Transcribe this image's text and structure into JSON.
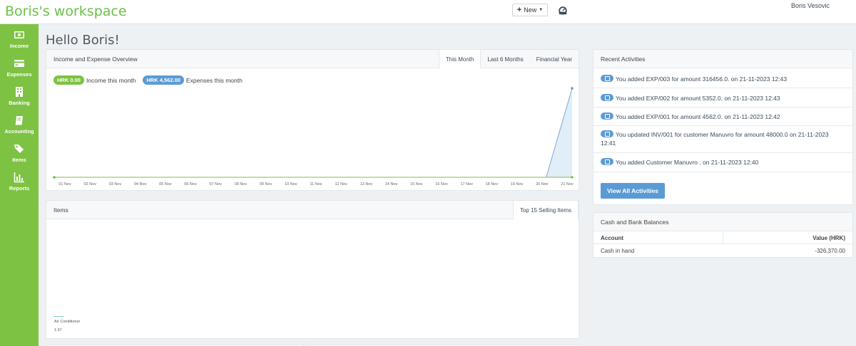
{
  "header": {
    "brand": "Boris's workspace",
    "new_button": "New",
    "user_name": "Boris Vesovic"
  },
  "sidebar": {
    "items": [
      {
        "label": "Income",
        "icon": "money-icon"
      },
      {
        "label": "Expenses",
        "icon": "credit-card-icon"
      },
      {
        "label": "Banking",
        "icon": "building-icon"
      },
      {
        "label": "Accounting",
        "icon": "book-icon"
      },
      {
        "label": "Items",
        "icon": "tags-icon"
      },
      {
        "label": "Reports",
        "icon": "bar-chart-icon"
      }
    ]
  },
  "main": {
    "greeting": "Hello Boris!"
  },
  "overview": {
    "title": "Income and Expense Overview",
    "tabs": [
      "This Month",
      "Last 6 Months",
      "Financial Year"
    ],
    "active_tab": "This Month",
    "income_badge": "HRK 0.00",
    "income_label": "Income this month",
    "expense_badge": "HRK 4,562.00",
    "expense_label": "Expenses this month"
  },
  "chart_data": {
    "type": "area",
    "categories": [
      "01 Nov",
      "02 Nov",
      "03 Nov",
      "04 Nov",
      "05 Nov",
      "06 Nov",
      "07 Nov",
      "08 Nov",
      "09 Nov",
      "10 Nov",
      "11 Nov",
      "12 Nov",
      "13 Nov",
      "14 Nov",
      "15 Nov",
      "16 Nov",
      "17 Nov",
      "18 Nov",
      "19 Nov",
      "20 Nov",
      "21 Nov"
    ],
    "series": [
      {
        "name": "Income this month",
        "color": "#7dc242",
        "values": [
          0,
          0,
          0,
          0,
          0,
          0,
          0,
          0,
          0,
          0,
          0,
          0,
          0,
          0,
          0,
          0,
          0,
          0,
          0,
          0,
          0
        ]
      },
      {
        "name": "Expenses this month",
        "color": "#5b9bd5",
        "values": [
          0,
          0,
          0,
          0,
          0,
          0,
          0,
          0,
          0,
          0,
          0,
          0,
          0,
          0,
          0,
          0,
          0,
          0,
          0,
          0,
          4562
        ]
      }
    ],
    "ylim": [
      0,
      4562
    ]
  },
  "items_panel": {
    "title": "Items",
    "tab": "Top 15 Selling Items",
    "item_label": "Air Conditioner",
    "item_value": "1.57"
  },
  "activities": {
    "title": "Recent Activities",
    "items": [
      "You added EXP/003 for amount 316456.0. on 21-11-2023 12:43",
      "You added EXP/002 for amount 5352.0. on 21-11-2023 12:43",
      "You added EXP/001 for amount 4562.0. on 21-11-2023 12:42",
      "You updated INV/001 for customer Manuvro for amount 48000.0 on 21-11-2023 12:41",
      "You added Customer Manuvro . on 21-11-2023 12:40"
    ],
    "view_all": "View All Activities"
  },
  "balances": {
    "title": "Cash and Bank Balances",
    "col_account": "Account",
    "col_value": "Value (HRK)",
    "rows": [
      {
        "account": "Cash in hand",
        "value": "-326,370.00"
      }
    ]
  },
  "colors": {
    "brand_green": "#7dc242",
    "accent_blue": "#5b9bd5"
  }
}
